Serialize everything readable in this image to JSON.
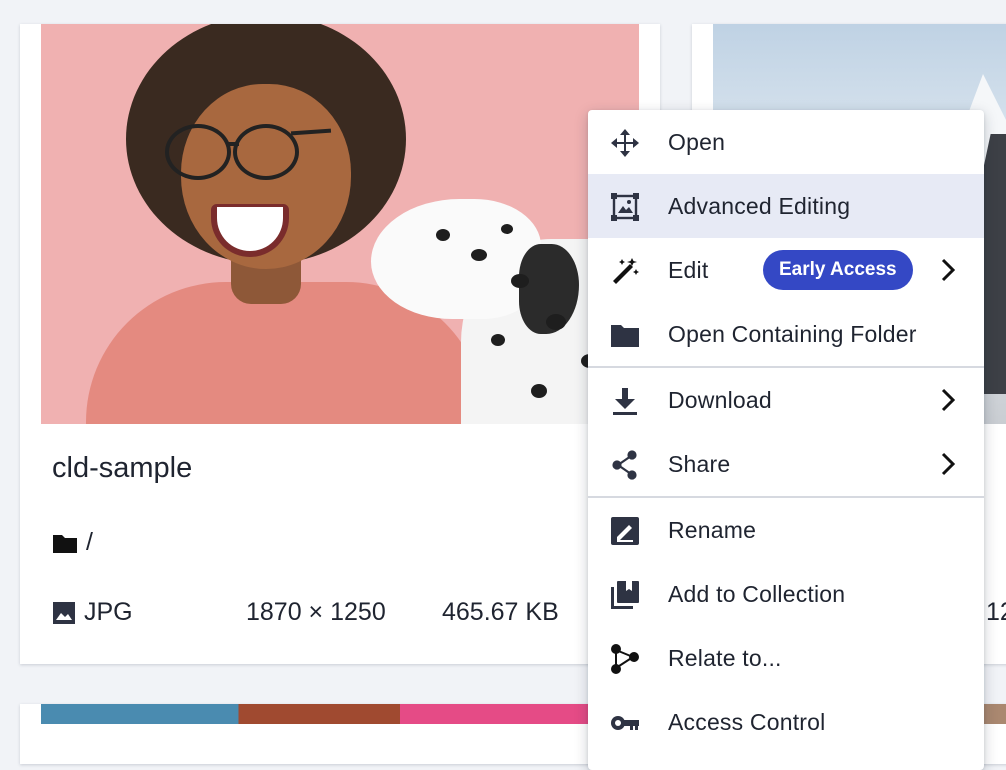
{
  "assets": [
    {
      "name": "cld-sample",
      "folder": "/",
      "format": "JPG",
      "dimensions": "1870 × 1250",
      "size": "465.67 KB"
    },
    {
      "partial_meta": "12"
    }
  ],
  "context_menu": {
    "items": [
      {
        "label": "Open",
        "icon": "move-arrows-icon"
      },
      {
        "label": "Advanced Editing",
        "icon": "image-frame-icon",
        "state": "hovered"
      },
      {
        "label": "Edit",
        "icon": "magic-wand-icon",
        "badge": "Early Access",
        "submenu": true
      },
      {
        "label": "Open Containing Folder",
        "icon": "folder-icon"
      },
      {
        "label": "Download",
        "icon": "download-icon",
        "submenu": true
      },
      {
        "label": "Share",
        "icon": "share-icon",
        "submenu": true
      },
      {
        "label": "Rename",
        "icon": "rename-pencil-icon"
      },
      {
        "label": "Add to Collection",
        "icon": "collection-icon"
      },
      {
        "label": "Relate to...",
        "icon": "relate-graph-icon"
      },
      {
        "label": "Access Control",
        "icon": "key-icon"
      }
    ]
  },
  "colors": {
    "accent": "#3448c5",
    "hover_bg": "#e7eaf5",
    "page_bg": "#f1f3f7",
    "icon": "#2e3343"
  }
}
